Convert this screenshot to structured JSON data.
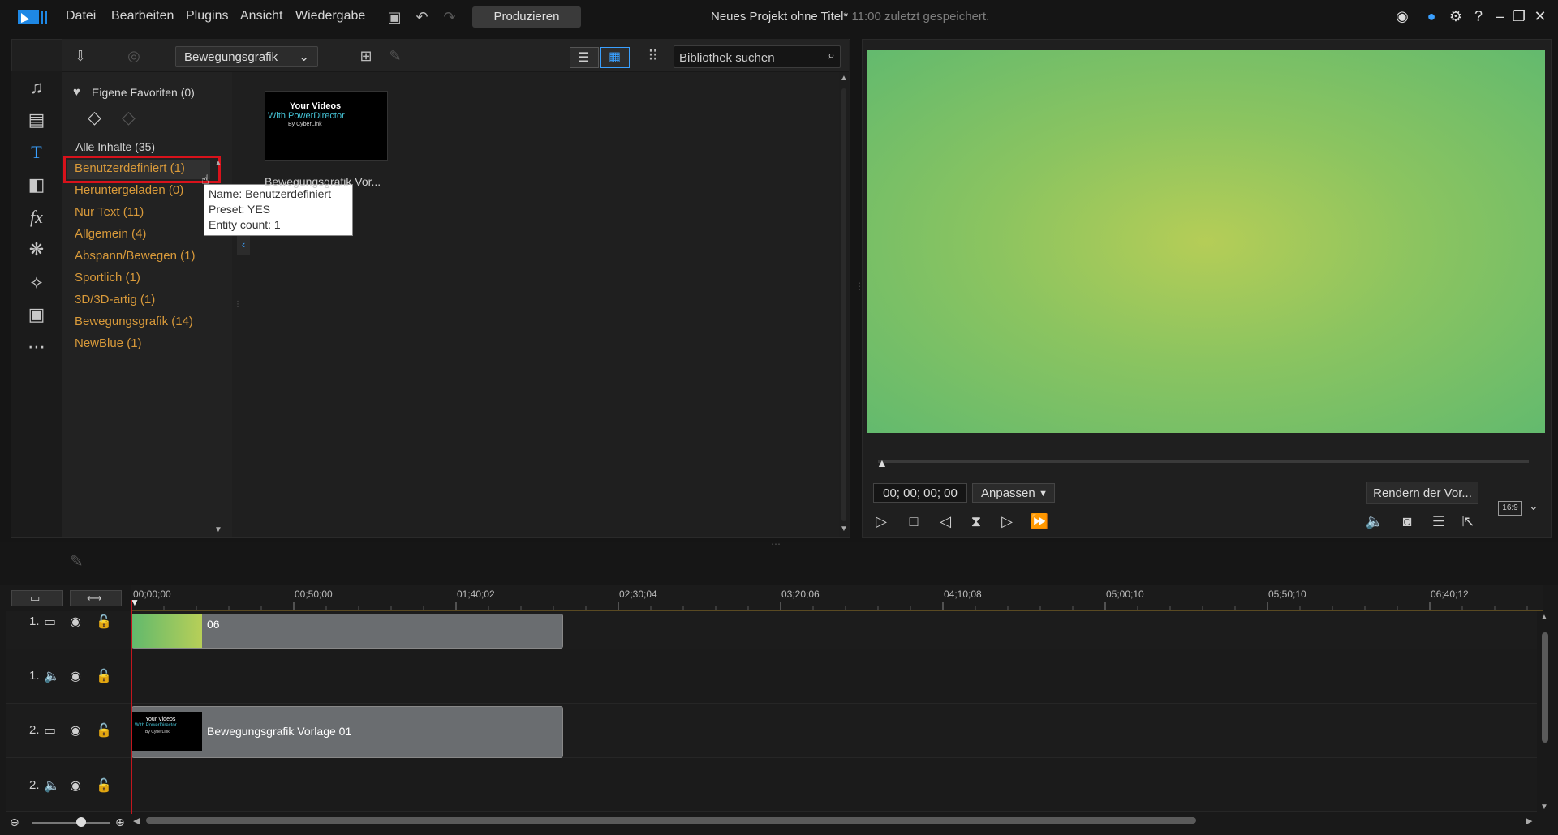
{
  "menu": {
    "items": [
      "Datei",
      "Bearbeiten",
      "Plugins",
      "Ansicht",
      "Wiedergabe"
    ],
    "produce_label": "Produzieren"
  },
  "window": {
    "title": "Neues Projekt ohne Titel*",
    "saved_status": "11:00 zuletzt gespeichert."
  },
  "library": {
    "dropdown_value": "Bewegungsgrafik",
    "search_placeholder": "Bibliothek suchen",
    "favorites_label": "Eigene Favoriten (0)",
    "all_label": "Alle Inhalte (35)",
    "categories": [
      "Benutzerdefiniert  (1)",
      "Heruntergeladen  (0)",
      "Nur Text  (11)",
      "Allgemein  (4)",
      "Abspann/Bewegen  (1)",
      "Sportlich  (1)",
      "3D/3D-artig  (1)",
      "Bewegungsgrafik  (14)",
      "NewBlue  (1)"
    ],
    "tooltip": {
      "line1": "Name: Benutzerdefiniert",
      "line2": "Preset: YES",
      "line3": "Entity count: 1"
    },
    "thumbnail": {
      "line1": "Your Videos",
      "line2": "With PowerDirector",
      "line3": "By CyberLink",
      "label": "Bewegungsgrafik Vor..."
    }
  },
  "preview": {
    "timecode": "00; 00; 00; 00",
    "fit_label": "Anpassen",
    "render_label": "Rendern der Vor...",
    "aspect_label": "16:9"
  },
  "timeline": {
    "ticks": [
      "00;00;00",
      "00;50;00",
      "01;40;02",
      "02;30;04",
      "03;20;06",
      "04;10;08",
      "05;00;10",
      "05;50;10",
      "06;40;12"
    ],
    "tracks": [
      {
        "num": "1.",
        "type": "video",
        "clip_label": "06"
      },
      {
        "num": "1.",
        "type": "audio",
        "clip_label": ""
      },
      {
        "num": "2.",
        "type": "video",
        "clip_label": "Bewegungsgrafik Vorlage 01"
      },
      {
        "num": "2.",
        "type": "audio",
        "clip_label": ""
      }
    ]
  },
  "colors": {
    "accent": "#3aa0ff",
    "category_text": "#d99a3a",
    "selection_border": "#d8121b",
    "playhead": "#c2171e"
  }
}
